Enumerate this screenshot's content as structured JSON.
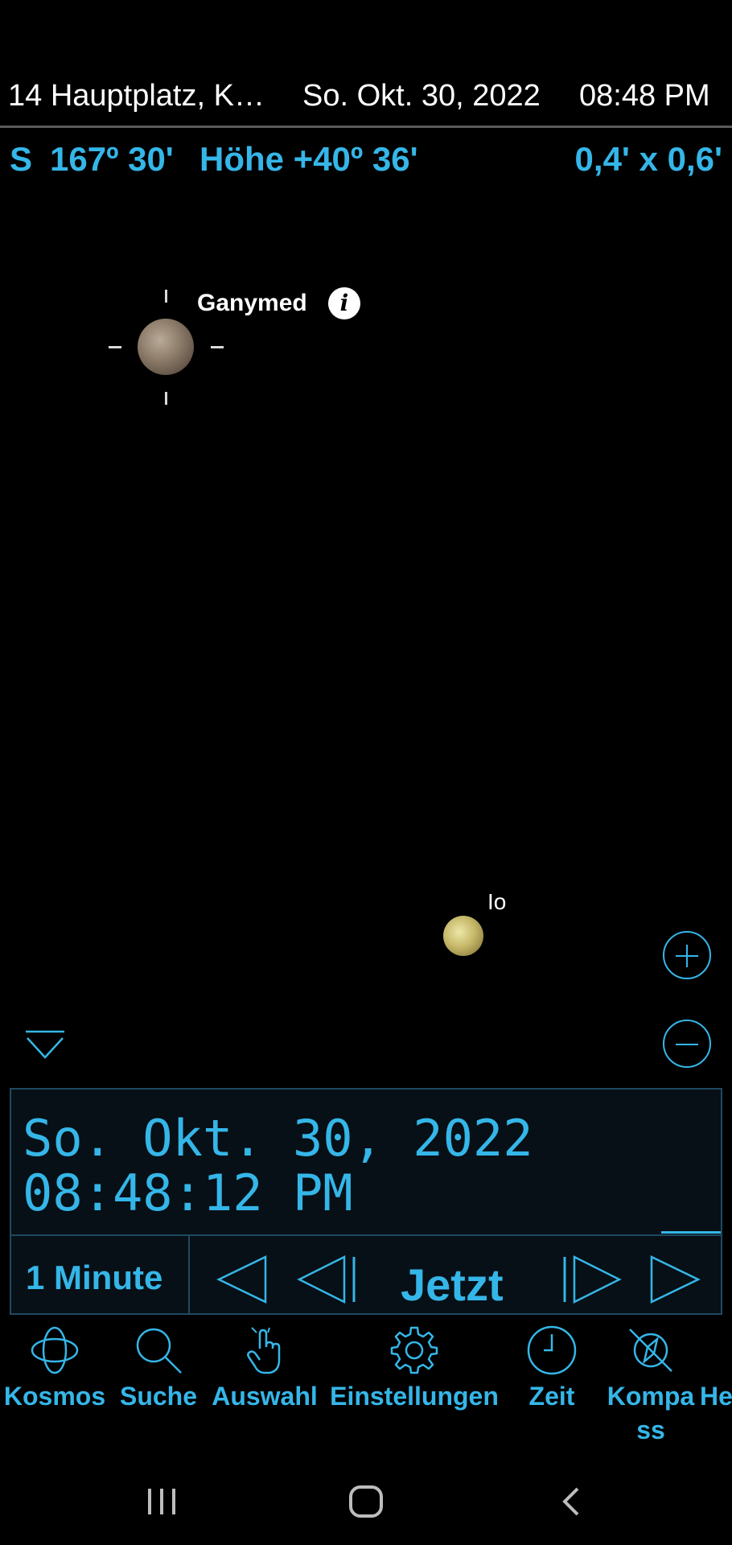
{
  "header": {
    "location": "14 Hauptplatz, K…",
    "date": "So. Okt. 30, 2022",
    "time": "08:48 PM"
  },
  "coordinates": {
    "direction": "S",
    "azimuth": "167º 30'",
    "altitude": "Höhe +40º 36'",
    "field_of_view": "0,4' x  0,6'"
  },
  "sky_objects": [
    {
      "name": "Ganymed",
      "selected": true,
      "info_icon": "info-icon"
    },
    {
      "name": "Io",
      "selected": false
    }
  ],
  "zoom": {
    "in_icon": "plus-icon",
    "out_icon": "minus-icon"
  },
  "time_panel": {
    "date": "So. Okt. 30, 2022",
    "time": "08:48:12 PM",
    "step": "1 Minute",
    "now_label": "Jetzt"
  },
  "bottom_nav": [
    {
      "label": "Kosmos",
      "icon": "orbit-icon"
    },
    {
      "label": "Suche",
      "icon": "search-icon"
    },
    {
      "label": "Auswahl",
      "icon": "hand-pointer-icon"
    },
    {
      "label": "Einstellungen",
      "icon": "gear-icon"
    },
    {
      "label": "Zeit",
      "icon": "clock-icon"
    },
    {
      "label": "Kompa ss",
      "line1": "Kompa",
      "line2": "ss",
      "icon": "compass-off-icon"
    },
    {
      "label": "He",
      "icon": ""
    }
  ],
  "colors": {
    "accent": "#35b6e8",
    "background": "#000000",
    "panel_background": "#071016",
    "panel_border": "#1f4a60"
  }
}
